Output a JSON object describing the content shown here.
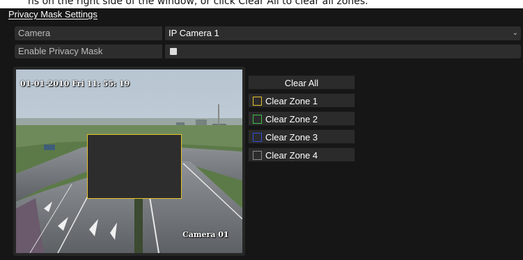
{
  "caption": {
    "text": "ns on the right side of the window, or click Clear All to clear all zones."
  },
  "window": {
    "title": "Privacy Mask Settings"
  },
  "form": {
    "camera_label": "Camera",
    "camera_value": "IP Camera 1",
    "enable_label": "Enable Privacy Mask",
    "enable_checked": false
  },
  "preview": {
    "osd_time": "01-01-2010  Fri 11: 55: 19",
    "osd_camera": "Camera 01"
  },
  "buttons": {
    "clear_all": "Clear All",
    "zones": [
      {
        "label": "Clear Zone 1",
        "color": "#e6c32a"
      },
      {
        "label": "Clear Zone 2",
        "color": "#3fc04a"
      },
      {
        "label": "Clear Zone 3",
        "color": "#2f4fd8"
      },
      {
        "label": "Clear Zone 4",
        "color": "#8a8a8a"
      }
    ]
  },
  "colors": {
    "mask_border": "#e6c32a",
    "panel_bg": "#161616",
    "field_bg": "#2d2d2d"
  }
}
